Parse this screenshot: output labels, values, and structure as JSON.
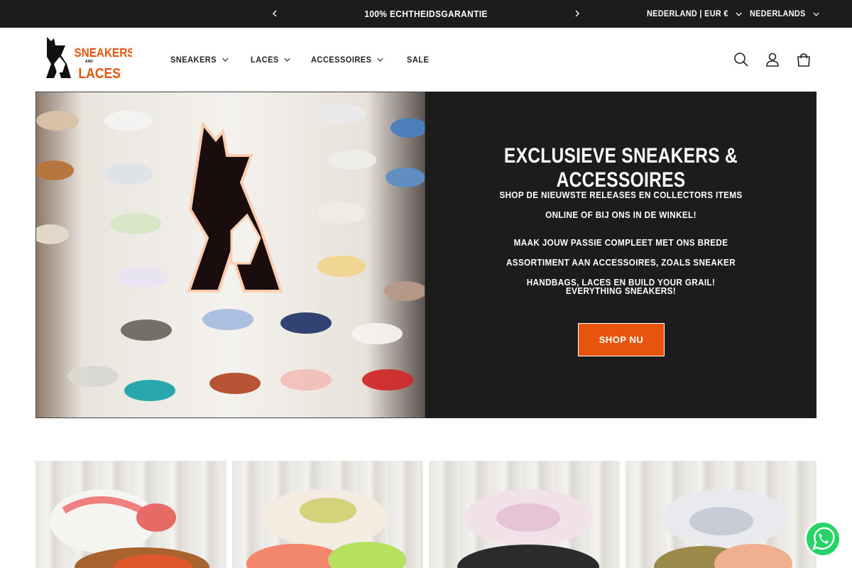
{
  "announcement": {
    "message": "100% ECHTHEIDSGARANTIE",
    "country_currency": "NEDERLAND | EUR €",
    "language": "NEDERLANDS"
  },
  "header": {
    "logo_text": "SNEAKERS AND LACES",
    "nav": [
      "SNEAKERS",
      "LACES",
      "ACCESSOIRES",
      "SALE"
    ]
  },
  "hero": {
    "title": "EXCLUSIEVE SNEAKERS & ACCESSOIRES",
    "paragraph_1": "SHOP DE NIEUWSTE RELEASES EN COLLECTORS ITEMS ONLINE OF BIJ ONS IN DE WINKEL!",
    "paragraph_2": "MAAK JOUW PASSIE COMPLEET MET ONS BREDE ASSORTIMENT AAN ACCESSOIRES, ZOALS SNEAKER HANDBAGS, LACES EN BUILD YOUR GRAIL!",
    "paragraph_3": "EVERYTHING SNEAKERS!",
    "button": "SHOP NU"
  },
  "colors": {
    "accent": "#e9540d",
    "dark": "#1c1c1c",
    "whatsapp": "#25d366"
  },
  "icons": [
    "chevron-left-icon",
    "chevron-right-icon",
    "chevron-down-icon",
    "search-icon",
    "account-icon",
    "cart-icon",
    "whatsapp-icon"
  ]
}
